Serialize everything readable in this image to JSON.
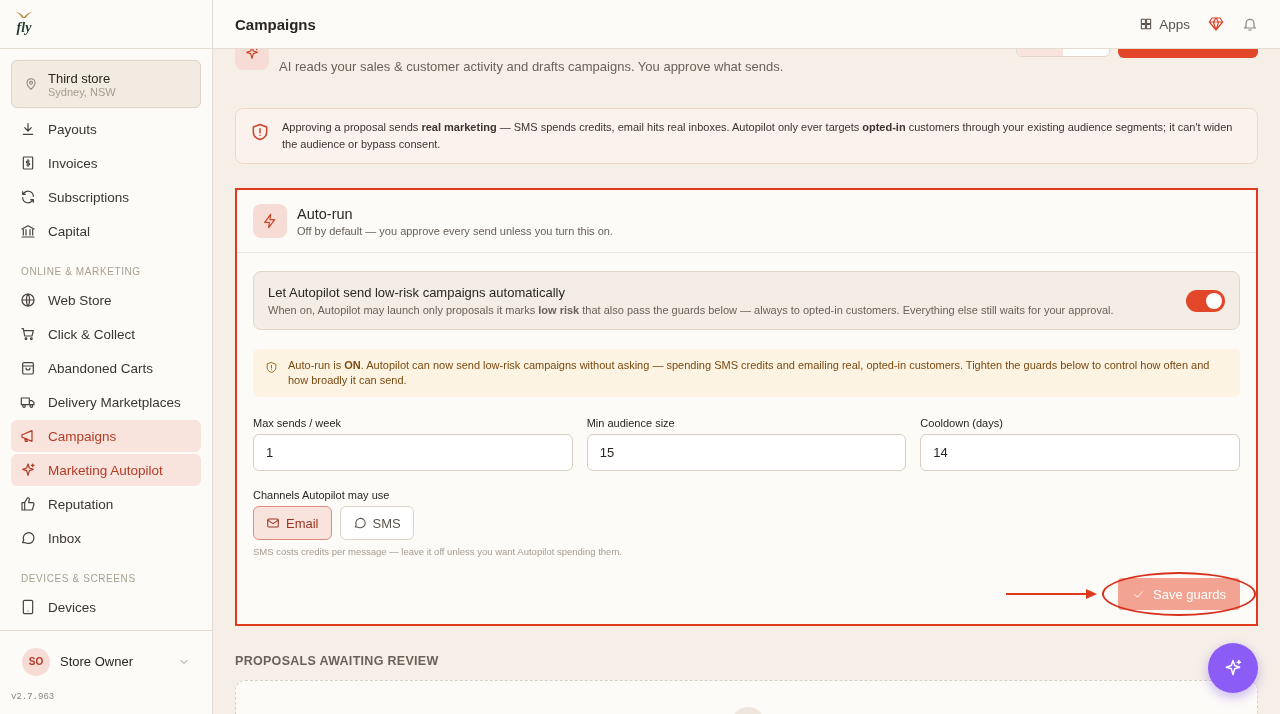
{
  "sidebar": {
    "logo": "fly",
    "store": {
      "name": "Third store",
      "location": "Sydney, NSW"
    },
    "sections": [
      {
        "items": [
          {
            "label": "Payouts",
            "selected": false
          },
          {
            "label": "Invoices",
            "selected": false
          },
          {
            "label": "Subscriptions",
            "selected": false
          },
          {
            "label": "Capital",
            "selected": false
          }
        ]
      },
      {
        "heading": "ONLINE & MARKETING",
        "items": [
          {
            "label": "Web Store",
            "selected": false
          },
          {
            "label": "Click & Collect",
            "selected": false
          },
          {
            "label": "Abandoned Carts",
            "selected": false
          },
          {
            "label": "Delivery Marketplaces",
            "selected": false
          },
          {
            "label": "Campaigns",
            "selected": true
          },
          {
            "label": "Marketing Autopilot",
            "selected": true
          },
          {
            "label": "Reputation",
            "selected": false
          },
          {
            "label": "Inbox",
            "selected": false
          }
        ]
      },
      {
        "heading": "DEVICES & SCREENS",
        "items": [
          {
            "label": "Devices",
            "selected": false
          }
        ]
      }
    ],
    "user": {
      "initials": "SO",
      "name": "Store Owner"
    },
    "version": "v2.7.963"
  },
  "header": {
    "title": "Campaigns",
    "apps": "Apps"
  },
  "page": {
    "subtitle": "AI reads your sales & customer activity and drafts campaigns. You approve what sends.",
    "channel_switch": [
      {
        "selected": true
      },
      {
        "selected": false
      }
    ]
  },
  "notice": "Approving a proposal sends **real marketing** — SMS spends credits, email hits real inboxes. Autopilot only ever targets **opted-in** customers through your existing audience segments; it can't widen the audience or bypass consent.",
  "autorun": {
    "title": "Auto-run",
    "subtitle": "Off by default — you approve every send unless you turn this on.",
    "toggle": {
      "label": "Let Autopilot send low-risk campaigns automatically",
      "description": "When on, Autopilot may launch only proposals it marks **low risk** that also pass the guards below — always to opted-in customers. Everything else still waits for your approval.",
      "on": true
    },
    "warning": "Auto-run is **ON**. Autopilot can now send low-risk campaigns without asking — spending SMS credits and emailing real, opted-in customers. Tighten the guards below to control how often and how broadly it can send.",
    "fields": [
      {
        "label": "Max sends / week",
        "value": "1"
      },
      {
        "label": "Min audience size",
        "value": "15"
      },
      {
        "label": "Cooldown (days)",
        "value": "14"
      }
    ],
    "channels_label": "Channels Autopilot may use",
    "channels": [
      {
        "label": "Email",
        "selected": true
      },
      {
        "label": "SMS",
        "selected": false
      }
    ],
    "channels_hint": "SMS costs credits per message — leave it off unless you want Autopilot spending them.",
    "save_button": {
      "label": "Save guards",
      "disabled": true
    }
  },
  "proposals": {
    "heading": "PROPOSALS AWAITING REVIEW"
  }
}
